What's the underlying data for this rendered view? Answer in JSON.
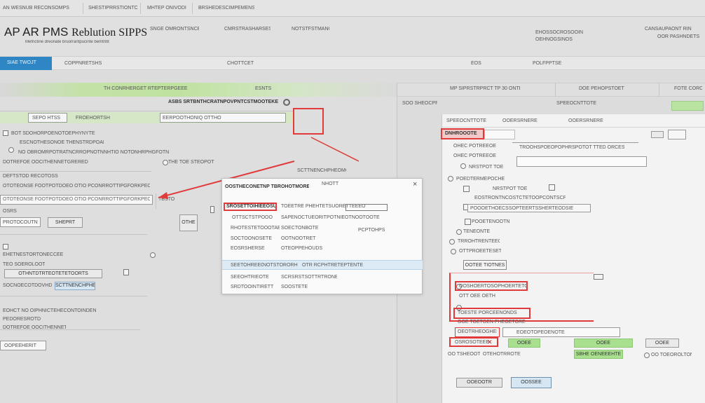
{
  "top_tabs": [
    "AN WESNUB RECONSOMPS",
    "SHESTIPRRSTIONTO",
    "MHTEP ONIVODI",
    "BRSHEDESCIMPEMENS"
  ],
  "app": {
    "title_main": "AP AR PMS",
    "title_sub": "Reblution SIPPS",
    "subtitle": "Mefnctine dreonate bruorrantpucinte bemtntit",
    "header_items": [
      "SNGE OMRONTSNCES",
      "CMRSTRASHARSES",
      "NOTSTFSTMANOE"
    ],
    "header_right": [
      "EHOSSOCROSOOINS",
      "OEHNOGSINOS"
    ],
    "header_far_right": [
      "CANSAUPAONT RIN",
      "OOR PASHNDETS"
    ]
  },
  "nav": {
    "active_tab": "SIAE TWOJT",
    "items": [
      "COPPNRETSHS",
      "CHOTTCET",
      "EOS",
      "POLFPPTSE"
    ]
  },
  "band": {
    "left": "TH CONRHERGET RTEPTERPGEEE",
    "middle": "ESNTS",
    "right_mid": "MP SIPRSTRPRCT TP 30 ONTET",
    "right1": "DOE PEHOPSTOET",
    "right2": "FOTE COROE"
  },
  "left_panel": {
    "search_title": "ASBS SRTBNTHCRATNPOVPNTCSTMOOTEKE",
    "search_row": [
      "SEPO HTSS",
      "FROEHORTSH",
      "EERPOOTHONIQ OTTHO"
    ],
    "rows": [
      "BOT SDOHORPOENOTOEPHYNYTE",
      "ESCNOTHESONOE THENSTRDPOAETS",
      "NO OBROMRPOTRATNCRROPNOTNNHTIO NOTONHRPHGFOTN",
      "DOTREFOE OOCITHENNETGRERED",
      "THE TOE STEOPOT",
      "DEFTSTOD RECOTOSS",
      "OTOTEONSE FOOTPOTDOEO OTIO PCONRROTTIPGFORKPEOWCRHO DPTHE",
      "TBSTO",
      "OSRS",
      "PROTOCOUTNTERETONDCTSOOENHEIOE",
      "EHETNESTORTONECCEE",
      "TEO SOEROLOOTEOOTSOEES",
      "OTHNTDTRTEOTETETOORTS",
      "SOCNOECOTDOVHDETT EIE",
      "SCTTNENCHPHEOMOOTBERE",
      "EOHCT NO OIPHNICTEHECONTOINDEN",
      "PEDORESROTD"
    ],
    "button_apply": "SHEPRT",
    "button_small": "OTHE",
    "button_bottom": "OOPEEHERIT"
  },
  "modal": {
    "title": "OOSTHECONETNP TBROHOTMORE",
    "subtitle": "NHOTT",
    "close": "×",
    "heading_label": "SROSETTOIHIEEOSURTOE",
    "heading_value": "TOEETRE PHEHTETSUORETTEEEO",
    "rows": [
      {
        "label": "OTTSCTSTPOOO",
        "value": "SAPENOCTUEORITPOTNIEOTNOOTOOTE",
        "extra": ""
      },
      {
        "label": "RHOTESTETOOOTAE",
        "value": "SOECTONBOTE",
        "extra": "PCPTOHPS"
      },
      {
        "label": "SOCTOONOSETE",
        "value": "OOTNOOTRET",
        "extra": ""
      },
      {
        "label": "EOSRSHERSE",
        "value": "OTEOPPEHOUDS",
        "extra": ""
      },
      {
        "label": "SEETOHREEO",
        "value": "NOTSTORORHE",
        "extra": "OTR RCPHTRETEPTENTE"
      },
      {
        "label": "SEEOHTRIEOTE",
        "value": "SCRSRSTSOTTRTRONE",
        "extra": ""
      },
      {
        "label": "SRDTOOINTIRETT",
        "value": "SOOSTETE",
        "extra": ""
      }
    ]
  },
  "right_panel": {
    "top_text": "SOO SHEOCPREEET",
    "header": [
      "SPEEOCNTTOTE",
      "OOERSRNERE"
    ],
    "highlight_field": "DNHROOOTE",
    "field_value": "TROOHSPOEOPOPHRSPOTOT TTED ORCESTSEORE",
    "radio_label": "OHEC POTREEOE",
    "group_title": "POEDTERMEPOCHE",
    "checkbox_rows": [
      "NRSTPOT TOE",
      "EOSTRONTNCOSTCTETOOPCONTSCPDEEE",
      "POOOETHOECSSOPTEERTSSHERTEODSIE",
      "POOETENOOTN",
      "TENEONTE",
      "TRROHTRENTEEOE",
      "OTTPROEETESETS"
    ],
    "action_button": "OOTEE TIOTNES",
    "red_group": [
      "OOSHOERTOSOPHOERTETOHHIEE",
      "OTT OEE OETH"
    ],
    "red_group2": "TOESTE PORCEENONDS",
    "red_group2_sub": "OOE TOETOEN PHEOETORE",
    "bottom_fields": [
      "OEOTRHEOGHEPR",
      "OSROSOTEEE"
    ],
    "bottom_links": [
      "SBHE OENEEEHTE",
      "OOEE"
    ],
    "bottom_checkbox": "OO TOEOROLTONE",
    "bottom_row": [
      "OO TSHEOOTE",
      "EOEOTOPEOENOTE",
      "OTEHOTRROTE"
    ],
    "footer_buttons": [
      "OOEOOTR",
      "OOSSEE"
    ]
  }
}
